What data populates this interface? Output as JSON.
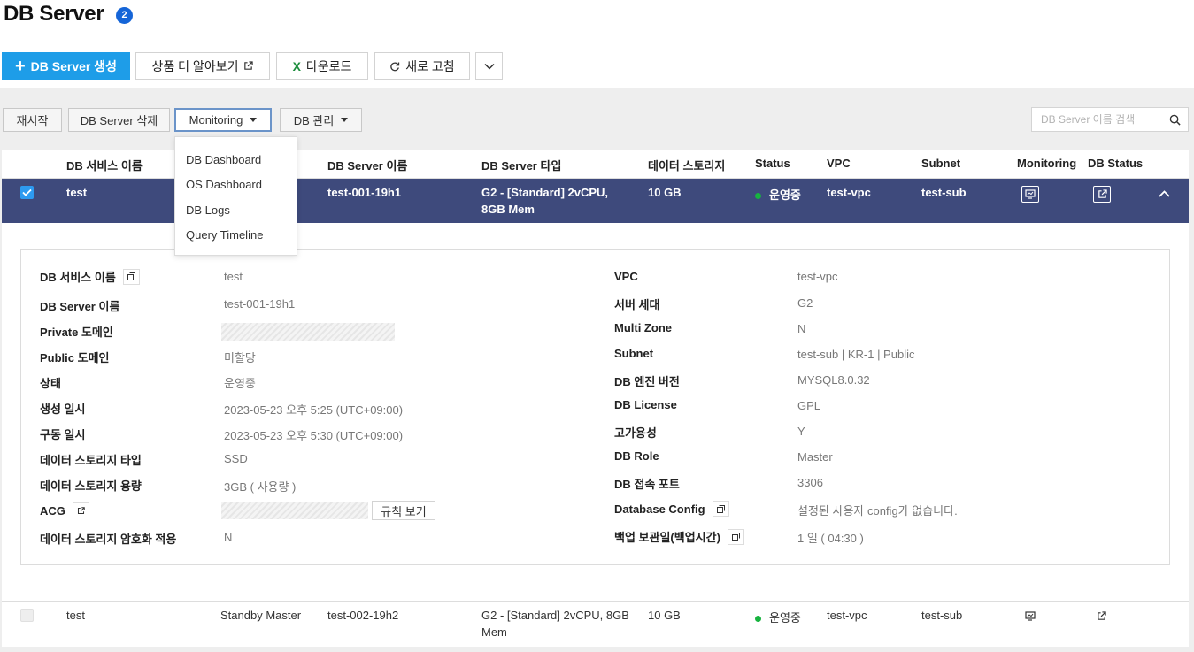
{
  "header": {
    "title": "DB Server",
    "count": "2"
  },
  "toolbar": {
    "create": "DB Server 생성",
    "learn_more": "상품 더 알아보기",
    "download": "다운로드",
    "download_icon": "X",
    "refresh": "새로 고침"
  },
  "actions": {
    "restart": "재시작",
    "delete": "DB Server 삭제",
    "monitoring": "Monitoring",
    "db_manage": "DB 관리"
  },
  "search": {
    "placeholder": "DB Server 이름 검색"
  },
  "monitoring_menu": [
    "DB Dashboard",
    "OS Dashboard",
    "DB Logs",
    "Query Timeline"
  ],
  "table": {
    "columns": [
      "DB 서비스 이름",
      "DB Server 이름",
      "DB Server 타입",
      "데이터 스토리지",
      "Status",
      "VPC",
      "Subnet",
      "Monitoring",
      "DB Status"
    ],
    "rows": [
      {
        "service_name": "test",
        "role": "",
        "server_name": "test-001-19h1",
        "type": "G2 - [Standard] 2vCPU, 8GB Mem",
        "storage": "10 GB",
        "status": "운영중",
        "vpc": "test-vpc",
        "subnet": "test-sub",
        "selected": true
      },
      {
        "service_name": "test",
        "role": "Standby Master",
        "server_name": "test-002-19h2",
        "type": "G2 - [Standard] 2vCPU, 8GB Mem",
        "storage": "10 GB",
        "status": "운영중",
        "vpc": "test-vpc",
        "subnet": "test-sub",
        "selected": false
      }
    ]
  },
  "detail": {
    "left": [
      {
        "label": "DB 서비스 이름",
        "value": "test",
        "copy": true
      },
      {
        "label": "DB Server 이름",
        "value": "test-001-19h1"
      },
      {
        "label": "Private 도메인",
        "value": ""
      },
      {
        "label": "Public 도메인",
        "value": "미할당"
      },
      {
        "label": "상태",
        "value": "운영중"
      },
      {
        "label": "생성 일시",
        "value": "2023-05-23 오후 5:25 (UTC+09:00)"
      },
      {
        "label": "구동 일시",
        "value": "2023-05-23 오후 5:30 (UTC+09:00)"
      },
      {
        "label": "데이터 스토리지 타입",
        "value": "SSD"
      },
      {
        "label": "데이터 스토리지 용량",
        "value": "3GB ( 사용량 )"
      },
      {
        "label": "ACG",
        "value": "",
        "link": true
      },
      {
        "label": "데이터 스토리지 암호화 적용",
        "value": "N"
      }
    ],
    "right": [
      {
        "label": "VPC",
        "value": "test-vpc"
      },
      {
        "label": "서버 세대",
        "value": "G2"
      },
      {
        "label": "Multi Zone",
        "value": "N"
      },
      {
        "label": "Subnet",
        "value": "test-sub | KR-1 | Public"
      },
      {
        "label": "DB 엔진 버전",
        "value": "MYSQL8.0.32"
      },
      {
        "label": "DB License",
        "value": "GPL"
      },
      {
        "label": "고가용성",
        "value": "Y"
      },
      {
        "label": "DB Role",
        "value": "Master"
      },
      {
        "label": "DB 접속 포트",
        "value": "3306"
      },
      {
        "label": "Database Config",
        "value": "설정된 사용자 config가 없습니다.",
        "copy": true
      },
      {
        "label": "백업 보관일(백업시간)",
        "value": "1 일 ( 04:30 )",
        "copy": true
      }
    ],
    "rule_button": "규칙 보기"
  },
  "colors": {
    "primary": "#1e9de8",
    "selected_row": "#3e4a7c",
    "badge": "#1565d8",
    "status_ok": "#17b33f"
  }
}
